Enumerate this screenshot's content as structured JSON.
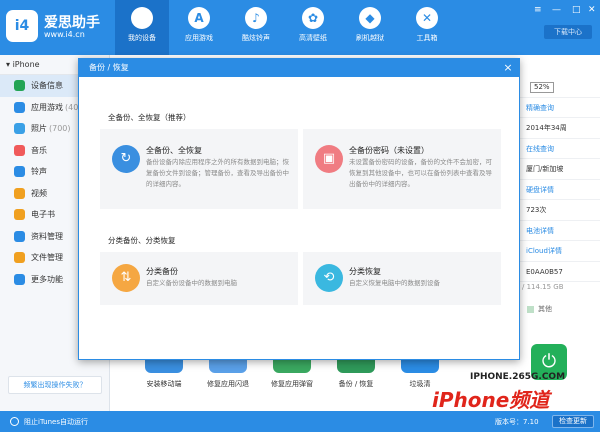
{
  "app": {
    "name": "爱思助手",
    "url": "www.i4.cn",
    "nav": [
      {
        "label": "我的设备",
        "icon": "apple-icon"
      },
      {
        "label": "应用游戏",
        "icon": "app-store-icon"
      },
      {
        "label": "酷炫铃声",
        "icon": "bell-icon"
      },
      {
        "label": "高清壁纸",
        "icon": "flower-icon"
      },
      {
        "label": "刷机越狱",
        "icon": "dropbox-icon"
      },
      {
        "label": "工具箱",
        "icon": "tools-icon"
      }
    ],
    "download_center": "下载中心"
  },
  "sidebar": {
    "device": "iPhone",
    "items": [
      {
        "label": "设备信息",
        "count": "",
        "color": "#23a455",
        "icon": "info-icon"
      },
      {
        "label": "应用游戏",
        "count": "(40",
        "color": "#2b8ce4",
        "icon": "apps-icon"
      },
      {
        "label": "照片",
        "count": "(700)",
        "color": "#3aa0e6",
        "icon": "photo-icon"
      },
      {
        "label": "音乐",
        "count": "",
        "color": "#f05a5a",
        "icon": "music-icon"
      },
      {
        "label": "铃声",
        "count": "",
        "color": "#2b8ce4",
        "icon": "ringtone-icon"
      },
      {
        "label": "视频",
        "count": "",
        "color": "#f0a020",
        "icon": "video-icon"
      },
      {
        "label": "电子书",
        "count": "",
        "color": "#f0a020",
        "icon": "book-icon"
      },
      {
        "label": "资料管理",
        "count": "",
        "color": "#2b8ce4",
        "icon": "data-icon"
      },
      {
        "label": "文件管理",
        "count": "",
        "color": "#f0a020",
        "icon": "folder-icon"
      },
      {
        "label": "更多功能",
        "count": "",
        "color": "#2b8ce4",
        "icon": "grid-icon"
      }
    ],
    "fail_link": "频繁出现操作失败？"
  },
  "background_info": {
    "battery_pct": "52%",
    "rows": [
      "精确查询",
      "2014年34周",
      "在线查询",
      "厦门/新加坡",
      "硬盘详情",
      "723次",
      "电池详情",
      "iCloud详情",
      "E0AA0B57"
    ],
    "storage": "/ 114.15 GB",
    "other": "其他"
  },
  "tools": [
    {
      "label": "安装移动端",
      "color": "#3a8fe0"
    },
    {
      "label": "修复应用闪退",
      "color": "#5aa0e8"
    },
    {
      "label": "修复应用弹窗",
      "color": "#3aa860"
    },
    {
      "label": "备份 / 恢复",
      "color": "#2f9a5a"
    },
    {
      "label": "垃圾清",
      "color": "#2b8ce4"
    }
  ],
  "watermark": {
    "line1": "IPHONE.265G.COM",
    "line2": "iPhone频道"
  },
  "status": {
    "itunes": "阻止iTunes自动运行",
    "version": "版本号：7.10",
    "update": "检查更新"
  },
  "modal": {
    "title": "备份 / 恢复",
    "close": "×",
    "section1": "全备份、全恢复（推荐）",
    "section2": "分类备份、分类恢复",
    "cards": [
      {
        "title": "全备份、全恢复",
        "desc": "备份设备内除应用程序之外的所有数据到电脑；恢复备份文件到设备；管理备份，查看及导出备份中的详细内容。",
        "color": "#3a8fe0",
        "icon": "restore-icon"
      },
      {
        "title": "全备份密码（未设置）",
        "desc": "未设置备份密码的设备，备份的文件不会加密，可恢复到其他设备中，也可以在备份列表中查看及导出备份中的详细内容。",
        "color": "#f07c82",
        "icon": "lock-icon"
      },
      {
        "title": "分类备份",
        "desc": "自定义备份设备中的数据到电脑",
        "color": "#f5a742",
        "icon": "backup-icon"
      },
      {
        "title": "分类恢复",
        "desc": "自定义恢复电脑中的数据到设备",
        "color": "#3ab8e0",
        "icon": "recover-icon"
      }
    ]
  }
}
